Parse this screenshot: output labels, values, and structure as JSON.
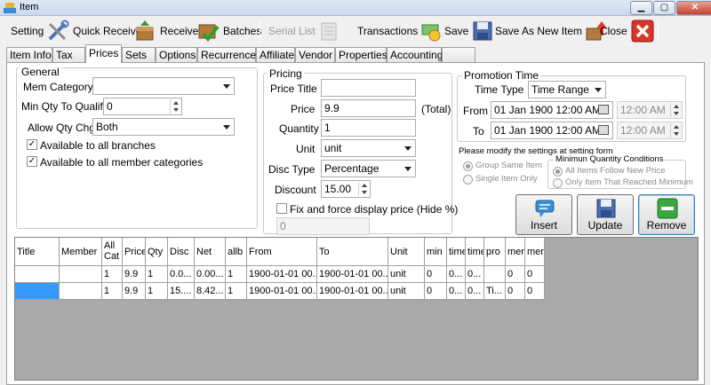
{
  "window": {
    "title": "Item",
    "min_label": "▁",
    "max_label": "▢",
    "close_label": "✕"
  },
  "toolbar": {
    "setting": "Setting",
    "quick_receive": "Quick Receive",
    "receive": "Receive",
    "batches": "Batches",
    "serial_list": "Serial List",
    "transactions": "Transactions",
    "save": "Save",
    "save_as_new": "Save As New Item",
    "close": "Close"
  },
  "tabs": [
    "Item Info",
    "Tax",
    "Prices",
    "Sets",
    "Options",
    "Recurrence",
    "Affiliate",
    "Vendor",
    "Properties",
    "Accounting"
  ],
  "general": {
    "title": "General",
    "mem_category_label": "Mem Category",
    "mem_category_value": "",
    "min_qty_label": "Min Qty To Qualify",
    "min_qty_value": "0",
    "allow_qty_label": "Allow Qty Chg",
    "allow_qty_value": "Both",
    "all_branches_label": "Available to all branches",
    "all_member_cats_label": "Available to all member categories",
    "check_mark": "✓"
  },
  "pricing": {
    "title": "Pricing",
    "price_title_label": "Price Title",
    "price_title_value": "",
    "price_label": "Price",
    "price_value": "9.9",
    "total_label": "(Total)",
    "quantity_label": "Quantity",
    "quantity_value": "1",
    "unit_label": "Unit",
    "unit_value": "unit",
    "disc_type_label": "Disc Type",
    "disc_type_value": "Percentage",
    "discount_label": "Discount",
    "discount_value": "15.00",
    "fix_price_label": "Fix and force display price (Hide %)",
    "fix_price_value": "0"
  },
  "promotion": {
    "title": "Promotion Time",
    "time_type_label": "Time Type",
    "time_type_value": "Time Range",
    "from_label": "From",
    "from_date": "01  Jan  1900 12:00 AM",
    "from_time": "12:00 AM",
    "to_label": "To",
    "to_date": "01  Jan  1900 12:00 AM",
    "to_time": "12:00 AM",
    "note": "Please modify the settings at setting form",
    "group_same": "Group Same Item",
    "single_only": "Single Item Only",
    "min_qty_cond_title": "Minimun Quantity Conditions",
    "all_items_follow": "All Items Follow New Price",
    "only_reached": "Only Item That Reached Minimum"
  },
  "actions": {
    "insert": "Insert",
    "update": "Update",
    "remove": "Remove"
  },
  "grid": {
    "headers": [
      "Title",
      "Member",
      "All\nCat",
      "Price",
      "Qty",
      "Disc",
      "Net",
      "allb",
      "From",
      "To",
      "Unit",
      "min",
      "time",
      "time",
      "pro",
      "mer",
      "mer"
    ],
    "rows": [
      [
        "",
        "",
        "1",
        "9.9",
        "1",
        "0.0...",
        "0.00...",
        "1",
        "1900-01-01 00...",
        "1900-01-01 00...",
        "unit",
        "0",
        "0...",
        "0...",
        "",
        "0",
        "0"
      ],
      [
        "",
        "",
        "1",
        "9.9",
        "1",
        "15....",
        "8.42...",
        "1",
        "1900-01-01 00...",
        "1900-01-01 00...",
        "unit",
        "0",
        "0...",
        "0...",
        "Ti...",
        "0",
        "0"
      ]
    ]
  },
  "colors": {
    "accent_selection": "#3399ff",
    "grid_background": "#a9a9a9",
    "remove_green": "#3aa742",
    "insert_blue": "#3a8fd8"
  }
}
